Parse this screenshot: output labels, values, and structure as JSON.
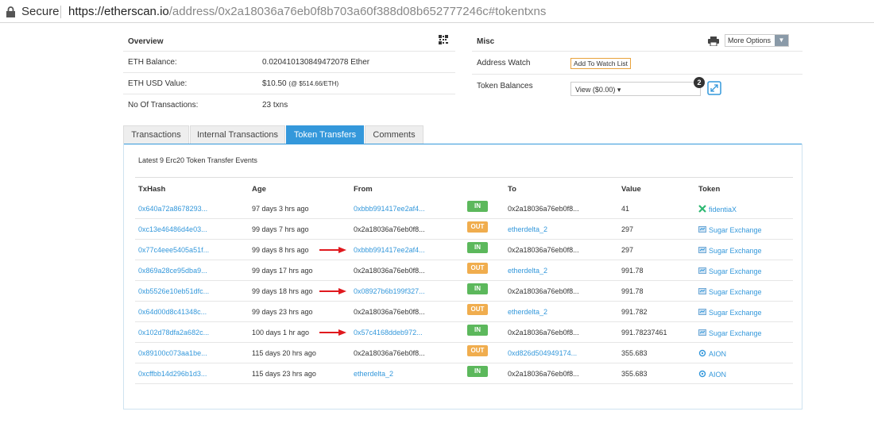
{
  "browser": {
    "secure_label": "Secure",
    "url_domain": "https://etherscan.io",
    "url_path": "/address/0x2a18036a76eb0f8b703a60f388d08b652777246c#tokentxns"
  },
  "overview": {
    "title": "Overview",
    "rows": [
      {
        "label": "ETH Balance:",
        "value": "0.020410130849472078 Ether"
      },
      {
        "label": "ETH USD Value:",
        "value": "$10.50",
        "extra": "(@ $514.66/ETH)"
      },
      {
        "label": "No Of Transactions:",
        "value": "23 txns"
      }
    ]
  },
  "misc": {
    "title": "Misc",
    "more_options": "More Options",
    "address_watch_label": "Address Watch",
    "add_watch_button": "Add To Watch List",
    "token_balances_label": "Token Balances",
    "token_select_value": "View ($0.00)",
    "token_count_badge": "2"
  },
  "tabs": [
    {
      "label": "Transactions",
      "active": false
    },
    {
      "label": "Internal Transactions",
      "active": false
    },
    {
      "label": "Token Transfers",
      "active": true
    },
    {
      "label": "Comments",
      "active": false
    }
  ],
  "transfers": {
    "caption": "Latest 9 Erc20 Token Transfer Events",
    "headers": {
      "txhash": "TxHash",
      "age": "Age",
      "from": "From",
      "to": "To",
      "value": "Value",
      "token": "Token"
    },
    "rows": [
      {
        "txhash": "0x640a72a8678293...",
        "age": "97 days 3 hrs ago",
        "from": "0xbbb991417ee2af4...",
        "from_link": true,
        "dir": "IN",
        "to": "0x2a18036a76eb0f8...",
        "to_link": false,
        "value": "41",
        "token": "fidentiaX",
        "token_icon": "fidentiax-icon",
        "arrow": false
      },
      {
        "txhash": "0xc13e46486d4e03...",
        "age": "99 days 7 hrs ago",
        "from": "0x2a18036a76eb0f8...",
        "from_link": false,
        "dir": "OUT",
        "to": "etherdelta_2",
        "to_link": true,
        "value": "297",
        "token": "Sugar Exchange",
        "token_icon": "sugar-exchange-icon",
        "arrow": false
      },
      {
        "txhash": "0x77c4eee5405a51f...",
        "age": "99 days 8 hrs ago",
        "from": "0xbbb991417ee2af4...",
        "from_link": true,
        "dir": "IN",
        "to": "0x2a18036a76eb0f8...",
        "to_link": false,
        "value": "297",
        "token": "Sugar Exchange",
        "token_icon": "sugar-exchange-icon",
        "arrow": true
      },
      {
        "txhash": "0x869a28ce95dba9...",
        "age": "99 days 17 hrs ago",
        "from": "0x2a18036a76eb0f8...",
        "from_link": false,
        "dir": "OUT",
        "to": "etherdelta_2",
        "to_link": true,
        "value": "991.78",
        "token": "Sugar Exchange",
        "token_icon": "sugar-exchange-icon",
        "arrow": false
      },
      {
        "txhash": "0xb5526e10eb51dfc...",
        "age": "99 days 18 hrs ago",
        "from": "0x08927b6b199f327...",
        "from_link": true,
        "dir": "IN",
        "to": "0x2a18036a76eb0f8...",
        "to_link": false,
        "value": "991.78",
        "token": "Sugar Exchange",
        "token_icon": "sugar-exchange-icon",
        "arrow": true
      },
      {
        "txhash": "0x64d00d8c41348c...",
        "age": "99 days 23 hrs ago",
        "from": "0x2a18036a76eb0f8...",
        "from_link": false,
        "dir": "OUT",
        "to": "etherdelta_2",
        "to_link": true,
        "value": "991.782",
        "token": "Sugar Exchange",
        "token_icon": "sugar-exchange-icon",
        "arrow": false
      },
      {
        "txhash": "0x102d78dfa2a682c...",
        "age": "100 days 1 hr ago",
        "from": "0x57c4168ddeb972...",
        "from_link": true,
        "dir": "IN",
        "to": "0x2a18036a76eb0f8...",
        "to_link": false,
        "value": "991.78237461",
        "token": "Sugar Exchange",
        "token_icon": "sugar-exchange-icon",
        "arrow": true
      },
      {
        "txhash": "0x89100c073aa1be...",
        "age": "115 days 20 hrs ago",
        "from": "0x2a18036a76eb0f8...",
        "from_link": false,
        "dir": "OUT",
        "to": "0xd826d504949174...",
        "to_link": true,
        "value": "355.683",
        "token": "AION",
        "token_icon": "aion-icon",
        "arrow": false
      },
      {
        "txhash": "0xcffbb14d296b1d3...",
        "age": "115 days 23 hrs ago",
        "from": "etherdelta_2",
        "from_link": true,
        "dir": "IN",
        "to": "0x2a18036a76eb0f8...",
        "to_link": false,
        "value": "355.683",
        "token": "AION",
        "token_icon": "aion-icon",
        "arrow": false
      }
    ]
  },
  "colors": {
    "accent": "#3498db",
    "in": "#5cb85c",
    "out": "#f0ad4e",
    "annotation_arrow": "#e0191e"
  }
}
